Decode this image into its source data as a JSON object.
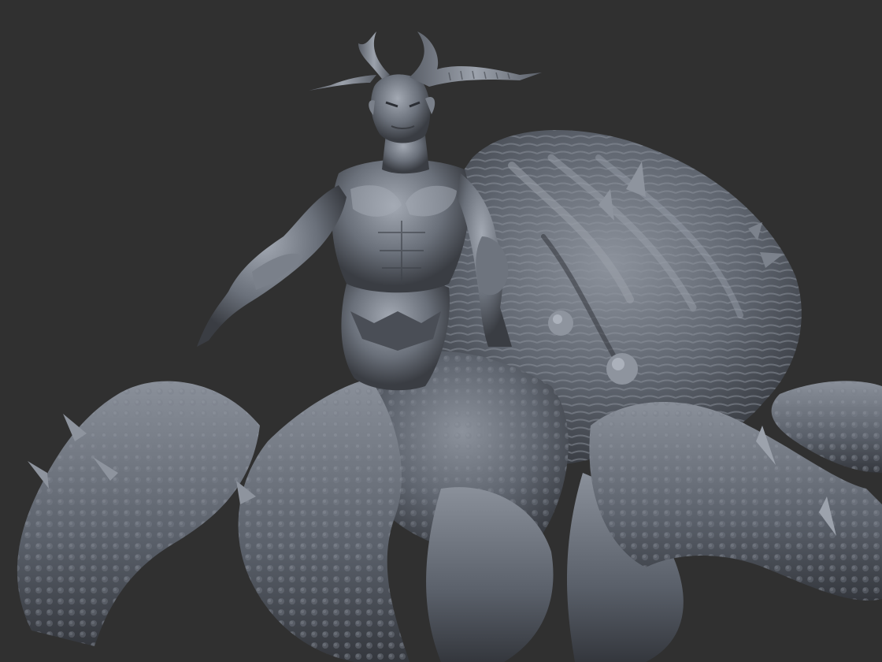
{
  "scene": {
    "background_color": "#303030",
    "model_base_color": "#5e646e",
    "model_highlight_color": "#9aa0aa",
    "model_shadow_color": "#2b2e34",
    "subjects": [
      "horned-demon-torso",
      "spider-beast-body",
      "spider-legs"
    ]
  }
}
